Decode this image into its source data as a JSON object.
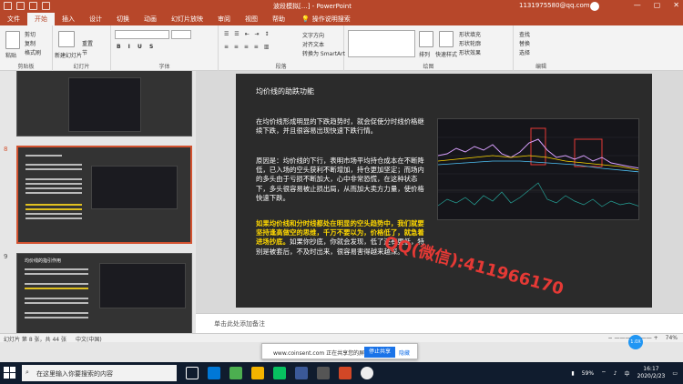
{
  "window": {
    "title": "波段模拟[…] - PowerPoint",
    "account": "1131975580@qq.com",
    "minimize": "—",
    "restore": "▢",
    "close": "✕"
  },
  "tabs": [
    "文件",
    "开始",
    "插入",
    "设计",
    "切换",
    "动画",
    "幻灯片放映",
    "审阅",
    "视图",
    "帮助"
  ],
  "tell_me": "操作说明搜索",
  "ribbon": {
    "clipboard": {
      "label": "剪贴板",
      "cut": "剪切",
      "copy": "复制",
      "format": "格式刷",
      "paste": "粘贴"
    },
    "slides": {
      "label": "幻灯片",
      "new_slide": "新建幻灯片",
      "reset": "重置",
      "section": "节"
    },
    "font": {
      "label": "字体"
    },
    "paragraph": {
      "label": "段落"
    },
    "drawing": {
      "label": "绘图",
      "text_direction": "文字方向",
      "align_text": "对齐文本",
      "smartart": "转换为 SmartArt",
      "shape_fill": "形状填充",
      "shape_outline": "形状轮廓",
      "shape_effects": "形状效果",
      "quick_styles": "快速样式",
      "arrange": "排列"
    },
    "editing": {
      "label": "编辑",
      "find": "查找",
      "replace": "替换",
      "select": "选择"
    }
  },
  "thumbnails": [
    {
      "number": "8"
    },
    {
      "number": "9",
      "title": "均价线的指引作用"
    }
  ],
  "slide": {
    "title": "均价线的助跌功能",
    "p1": "在均价线形成明显的下跌趋势时，就会促使分时线价格继续下跌，并且很容易出现快速下跌行情。",
    "p2": "原因是：均价线的下行，表明市场平均持仓成本在不断降低，已入场的空头获利不断增加，持仓更加坚定；而场内的多头由于亏损不断加大，心中非常恐慌，在这种状态下，多头很容易被止损出局，从而加大卖方力量，使价格快速下跌。",
    "p3_highlight": "如果均价线和分时线都处在明显的空头趋势中，我们就要坚持逢高做空的思维，千万不要以为，价格低了，就急着进场抄底。",
    "p3_rest": "如果你抄底，你就会发现，低了还有更低，特别是被套后，不及时出来，很容易害得越来越深。"
  },
  "notes_placeholder": "单击此处添加备注",
  "watermark": "QQ(微信):411966170",
  "status": {
    "slide_position": "幻灯片 第 8 张，共 44 张",
    "language": "中文(中国)",
    "zoom": "74%"
  },
  "popup": {
    "text": "www.coinsent.com 正在共享您的屏幕。",
    "stop_button": "停止共享",
    "hide": "隐藏"
  },
  "bubble": "1.0X",
  "taskbar": {
    "search_placeholder": "在这里输入你要搜索的内容",
    "battery": "59%",
    "time": "16:17",
    "date": "2020/2/23",
    "ime": "中"
  },
  "colors": {
    "accent": "#b7472a",
    "highlight": "#ffd800",
    "watermark": "#e53935"
  }
}
